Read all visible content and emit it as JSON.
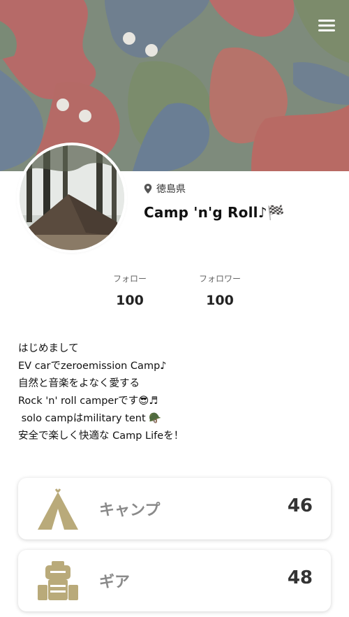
{
  "header": {
    "menu_icon": "hamburger-menu-icon"
  },
  "profile": {
    "location_icon": "map-pin-icon",
    "location": "徳島県",
    "name": "Camp 'n'g  Roll♪🏁"
  },
  "stats": {
    "follow_label": "フォロー",
    "follow_count": "100",
    "follower_label": "フォロワー",
    "follower_count": "100"
  },
  "bio": {
    "lines": [
      "はじめまして",
      "EV carでzeroemission Camp♪",
      "自然と音楽をよなく愛する",
      "Rock 'n' roll camperです😎♬",
      " solo campはmilitary tent 🪖",
      "安全で楽しく快適な Camp Lifeを！"
    ]
  },
  "cards": [
    {
      "icon": "teepee-tent-icon",
      "title": "キャンプ",
      "count": "46"
    },
    {
      "icon": "backpack-gear-icon",
      "title": "ギア",
      "count": "48"
    }
  ],
  "colors": {
    "accent": "#b9aa7a",
    "card_title": "#8a8a8a"
  }
}
